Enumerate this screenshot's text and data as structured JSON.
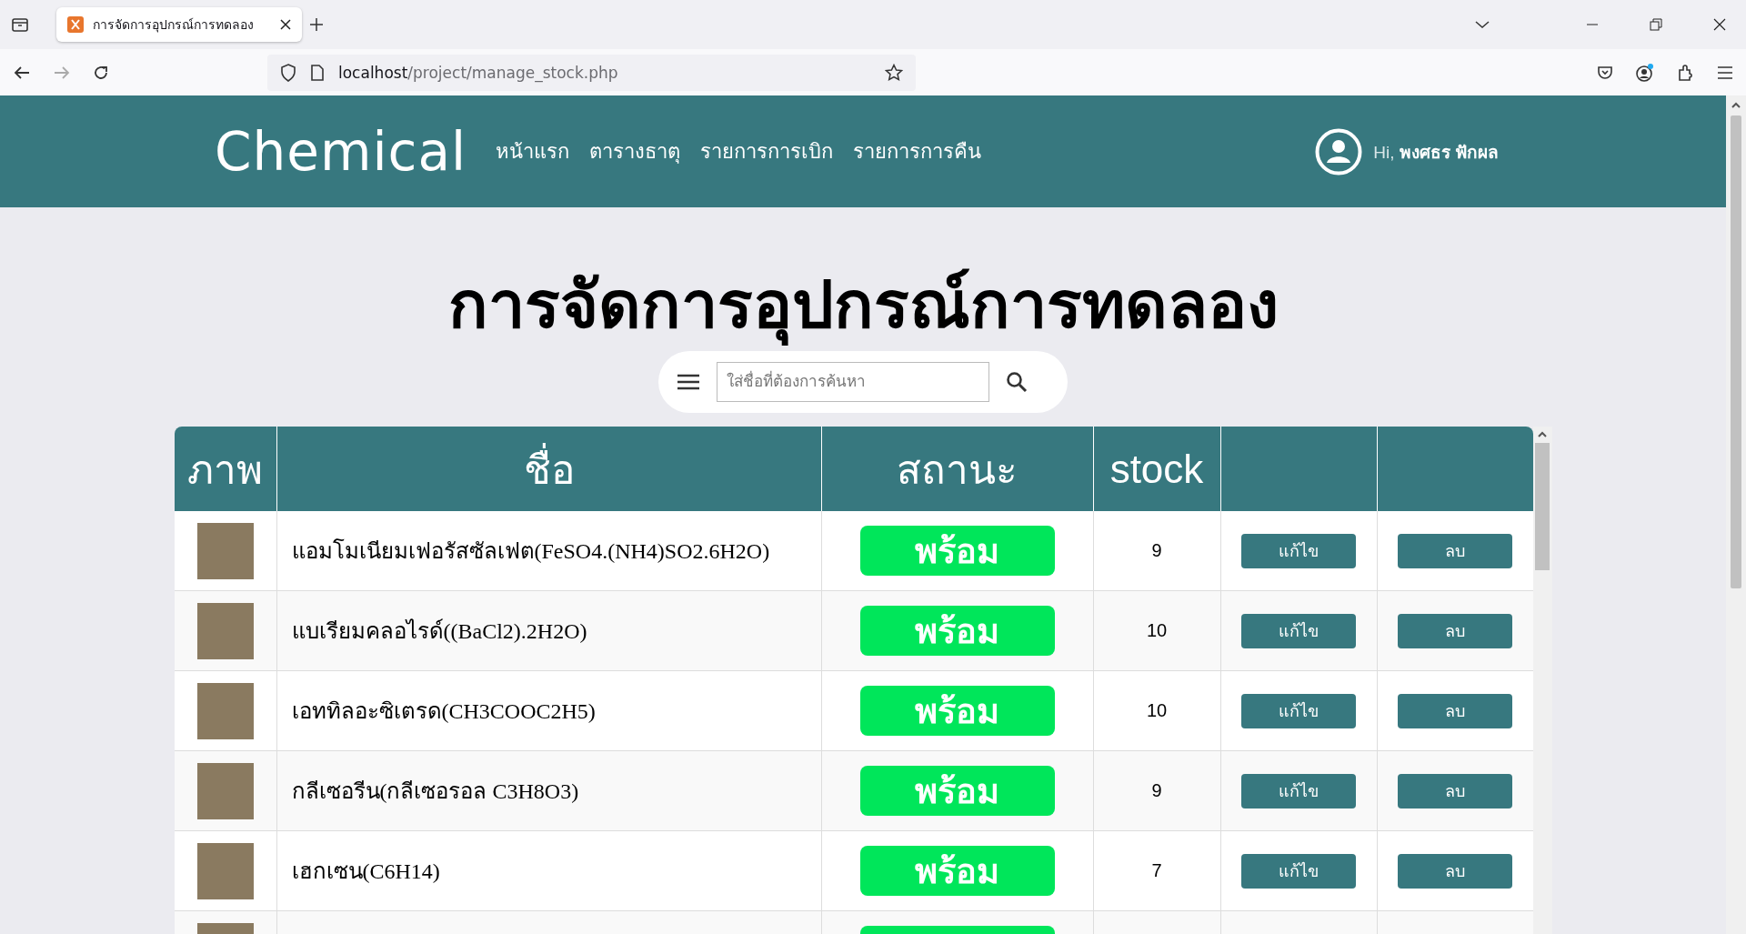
{
  "browser": {
    "tab_title": "การจัดการอุปกรณ์การทดลอง",
    "url_host": "localhost",
    "url_path": "/project/manage_stock.php"
  },
  "header": {
    "logo": "Chemical",
    "nav": [
      "หน้าแรก",
      "ตารางธาตุ",
      "รายการการเบิก",
      "รายการการคืน"
    ],
    "greeting": "Hi,",
    "user": "พงศธร ฟักผล"
  },
  "title": "การจัดการอุปกรณ์การทดลอง",
  "search": {
    "placeholder": "ใส่ชื่อที่ต้องการค้นหา"
  },
  "table": {
    "columns": [
      "ภาพ",
      "ชื่อ",
      "สถานะ",
      "stock"
    ],
    "rows": [
      {
        "name": "แอมโมเนียมเฟอรัสซัลเฟต(FeSO4.(NH4)SO2.6H2O)",
        "status": "พร้อม",
        "stock": "9",
        "edit": "แก้ไข",
        "delete": "ลบ"
      },
      {
        "name": "แบเรียมคลอไรด์((BaCl2).2H2O)",
        "status": "พร้อม",
        "stock": "10",
        "edit": "แก้ไข",
        "delete": "ลบ"
      },
      {
        "name": "เอททิลอะซิเตรด(CH3COOC2H5)",
        "status": "พร้อม",
        "stock": "10",
        "edit": "แก้ไข",
        "delete": "ลบ"
      },
      {
        "name": "กลีเซอรีน(กลีเซอรอล C3H8O3)",
        "status": "พร้อม",
        "stock": "9",
        "edit": "แก้ไข",
        "delete": "ลบ"
      },
      {
        "name": "เฮกเซน(C6H14)",
        "status": "พร้อม",
        "stock": "7",
        "edit": "แก้ไข",
        "delete": "ลบ"
      }
    ]
  }
}
